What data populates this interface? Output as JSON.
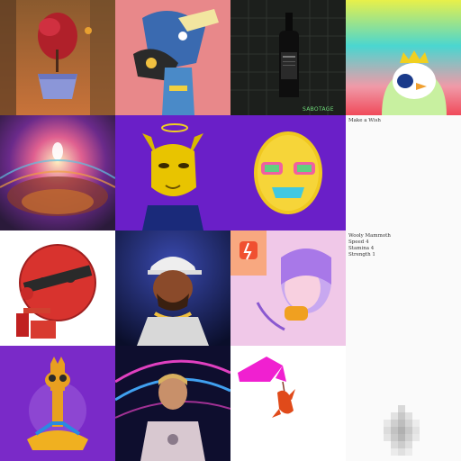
{
  "gallery": {
    "tiles": [
      {
        "name": "bonsai-tree-art",
        "caption": ""
      },
      {
        "name": "mechanical-creature-art",
        "caption": ""
      },
      {
        "name": "dark-bottle-art",
        "overlay_text": "SABOTAGE"
      },
      {
        "name": "penguin-king-art",
        "caption": ""
      },
      {
        "name": "psychedelic-mandala-art",
        "caption": ""
      },
      {
        "name": "yellow-dog-halo-art",
        "caption": ""
      },
      {
        "name": "fluffy-yellow-creature-art",
        "caption": ""
      },
      {
        "name": "make-a-wish-text-card",
        "lines": [
          "Make a Wish"
        ]
      },
      {
        "name": "red-robot-head-art",
        "caption": ""
      },
      {
        "name": "bearded-man-cap-art",
        "caption": ""
      },
      {
        "name": "pop-art-woman-phone",
        "caption": ""
      },
      {
        "name": "woolly-mammoth-text-card",
        "lines": [
          "Wooly Mammoth",
          "Speed 4",
          "Stamina 4",
          "Strength 1"
        ]
      },
      {
        "name": "giraffe-meditation-art",
        "caption": ""
      },
      {
        "name": "neon-avatar-man-art",
        "caption": ""
      },
      {
        "name": "pink-flower-creature-art",
        "caption": ""
      },
      {
        "name": "pixelated-blur-art",
        "caption": ""
      }
    ]
  },
  "colors": {
    "purple": "#6a1fc8",
    "pink": "#ec3aa0",
    "yellow": "#e8c400",
    "red": "#d8332e"
  }
}
